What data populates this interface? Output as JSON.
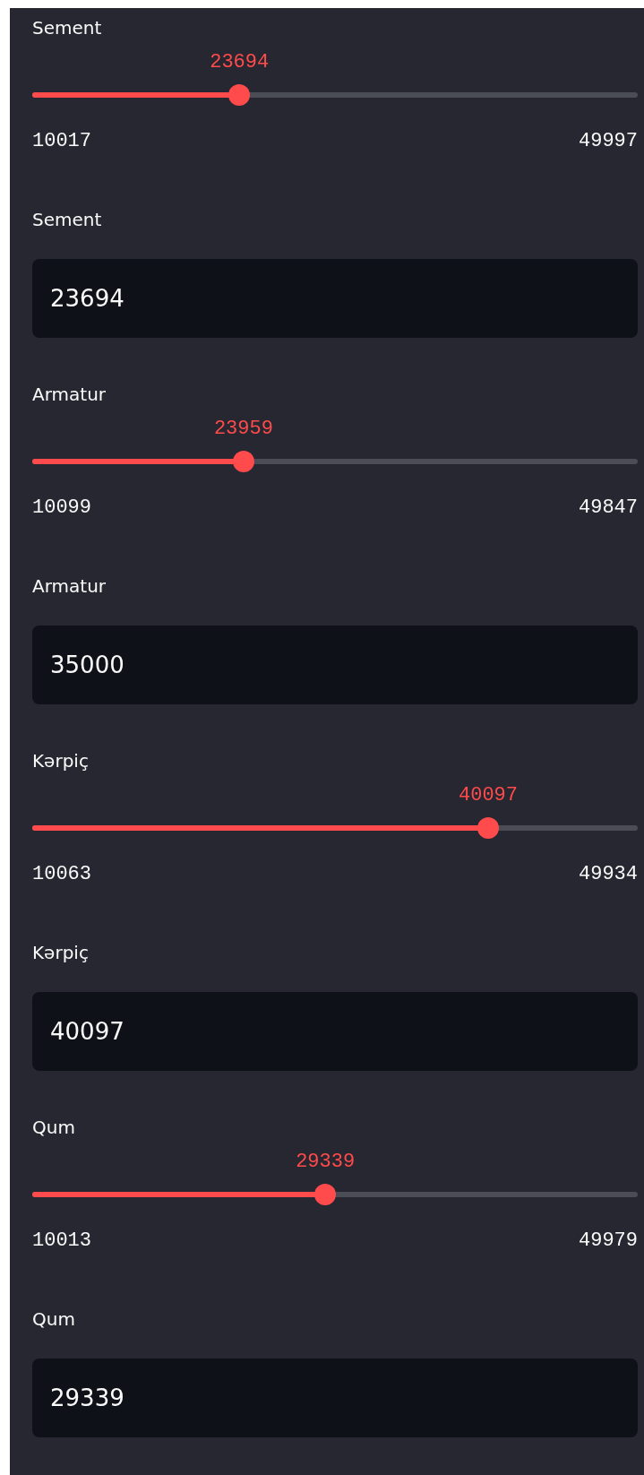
{
  "materials": [
    {
      "slider": {
        "label": "Sement",
        "value": "23694",
        "min": "10017",
        "max": "49997",
        "level": 0.342
      },
      "input": {
        "label": "Sement",
        "value": "23694"
      }
    },
    {
      "slider": {
        "label": "Armatur",
        "value": "23959",
        "min": "10099",
        "max": "49847",
        "level": 0.349
      },
      "input": {
        "label": "Armatur",
        "value": "35000"
      }
    },
    {
      "slider": {
        "label": "Kərpiç",
        "value": "40097",
        "min": "10063",
        "max": "49934",
        "level": 0.753
      },
      "input": {
        "label": "Kərpiç",
        "value": "40097"
      }
    },
    {
      "slider": {
        "label": "Qum",
        "value": "29339",
        "min": "10013",
        "max": "49979",
        "level": 0.484
      },
      "input": {
        "label": "Qum",
        "value": "29339"
      }
    }
  ]
}
